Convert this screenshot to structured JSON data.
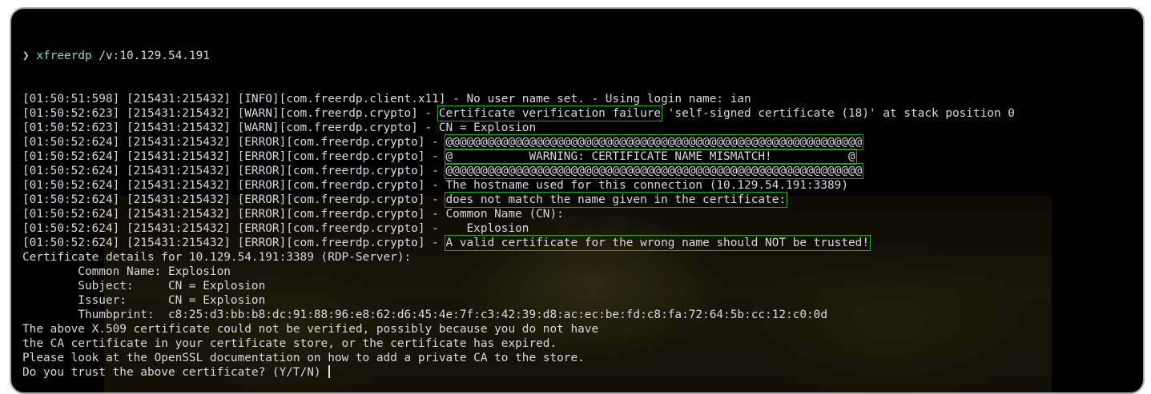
{
  "terminal": {
    "prompt": {
      "symbol": "❯",
      "command": "xfreerdp",
      "args": "/v:10.129.54.191"
    },
    "lines": [
      {
        "pre": "[01:50:51:598] [215431:215432] [INFO][com.freerdp.client.x11] - No user name set. - Using login name: ian",
        "hl": "",
        "post": ""
      },
      {
        "pre": "[01:50:52:623] [215431:215432] [WARN][com.freerdp.crypto] - ",
        "hl": "Certificate verification failure",
        "post": " 'self-signed certificate (18)' at stack position 0"
      },
      {
        "pre": "[01:50:52:623] [215431:215432] [WARN][com.freerdp.crypto] - CN = Explosion",
        "hl": "",
        "post": ""
      },
      {
        "pre": "[01:50:52:624] [215431:215432] [ERROR][com.freerdp.crypto] - ",
        "hl": "@@@@@@@@@@@@@@@@@@@@@@@@@@@@@@@@@@@@@@@@@@@@@@@@@@@@@@@@@@@@",
        "post": ""
      },
      {
        "pre": "[01:50:52:624] [215431:215432] [ERROR][com.freerdp.crypto] - ",
        "hl": "@           WARNING: CERTIFICATE NAME MISMATCH!           @",
        "post": ""
      },
      {
        "pre": "[01:50:52:624] [215431:215432] [ERROR][com.freerdp.crypto] - ",
        "hl": "@@@@@@@@@@@@@@@@@@@@@@@@@@@@@@@@@@@@@@@@@@@@@@@@@@@@@@@@@@@@",
        "post": ""
      },
      {
        "pre": "[01:50:52:624] [215431:215432] [ERROR][com.freerdp.crypto] - The hostname used for this connection (10.129.54.191:3389)",
        "hl": "",
        "post": ""
      },
      {
        "pre": "[01:50:52:624] [215431:215432] [ERROR][com.freerdp.crypto] - ",
        "hl": "does not match the name given in the certificate:",
        "post": ""
      },
      {
        "pre": "[01:50:52:624] [215431:215432] [ERROR][com.freerdp.crypto] - Common Name (CN):",
        "hl": "",
        "post": ""
      },
      {
        "pre": "[01:50:52:624] [215431:215432] [ERROR][com.freerdp.crypto] -    Explosion",
        "hl": "",
        "post": ""
      },
      {
        "pre": "[01:50:52:624] [215431:215432] [ERROR][com.freerdp.crypto] - ",
        "hl": "A valid certificate for the wrong name should NOT be trusted!",
        "post": ""
      },
      {
        "pre": "Certificate details for 10.129.54.191:3389 (RDP-Server):",
        "hl": "",
        "post": ""
      },
      {
        "pre": "        Common Name: Explosion",
        "hl": "",
        "post": ""
      },
      {
        "pre": "        Subject:     CN = Explosion",
        "hl": "",
        "post": ""
      },
      {
        "pre": "        Issuer:      CN = Explosion",
        "hl": "",
        "post": ""
      },
      {
        "pre": "        Thumbprint:  c8:25:d3:bb:b8:dc:91:88:96:e8:62:d6:45:4e:7f:c3:42:39:d8:ac:ec:be:fd:c8:fa:72:64:5b:cc:12:c0:0d",
        "hl": "",
        "post": ""
      },
      {
        "pre": "The above X.509 certificate could not be verified, possibly because you do not have",
        "hl": "",
        "post": ""
      },
      {
        "pre": "the CA certificate in your certificate store, or the certificate has expired.",
        "hl": "",
        "post": ""
      },
      {
        "pre": "Please look at the OpenSSL documentation on how to add a private CA to the store.",
        "hl": "",
        "post": ""
      },
      {
        "pre": "Do you trust the above certificate? (Y/T/N) ",
        "hl": "",
        "post": ""
      }
    ]
  },
  "colors": {
    "background": "#000000",
    "text": "#d8dae2",
    "command": "#8fd8c9",
    "highlight_box": "#1fa61f"
  }
}
